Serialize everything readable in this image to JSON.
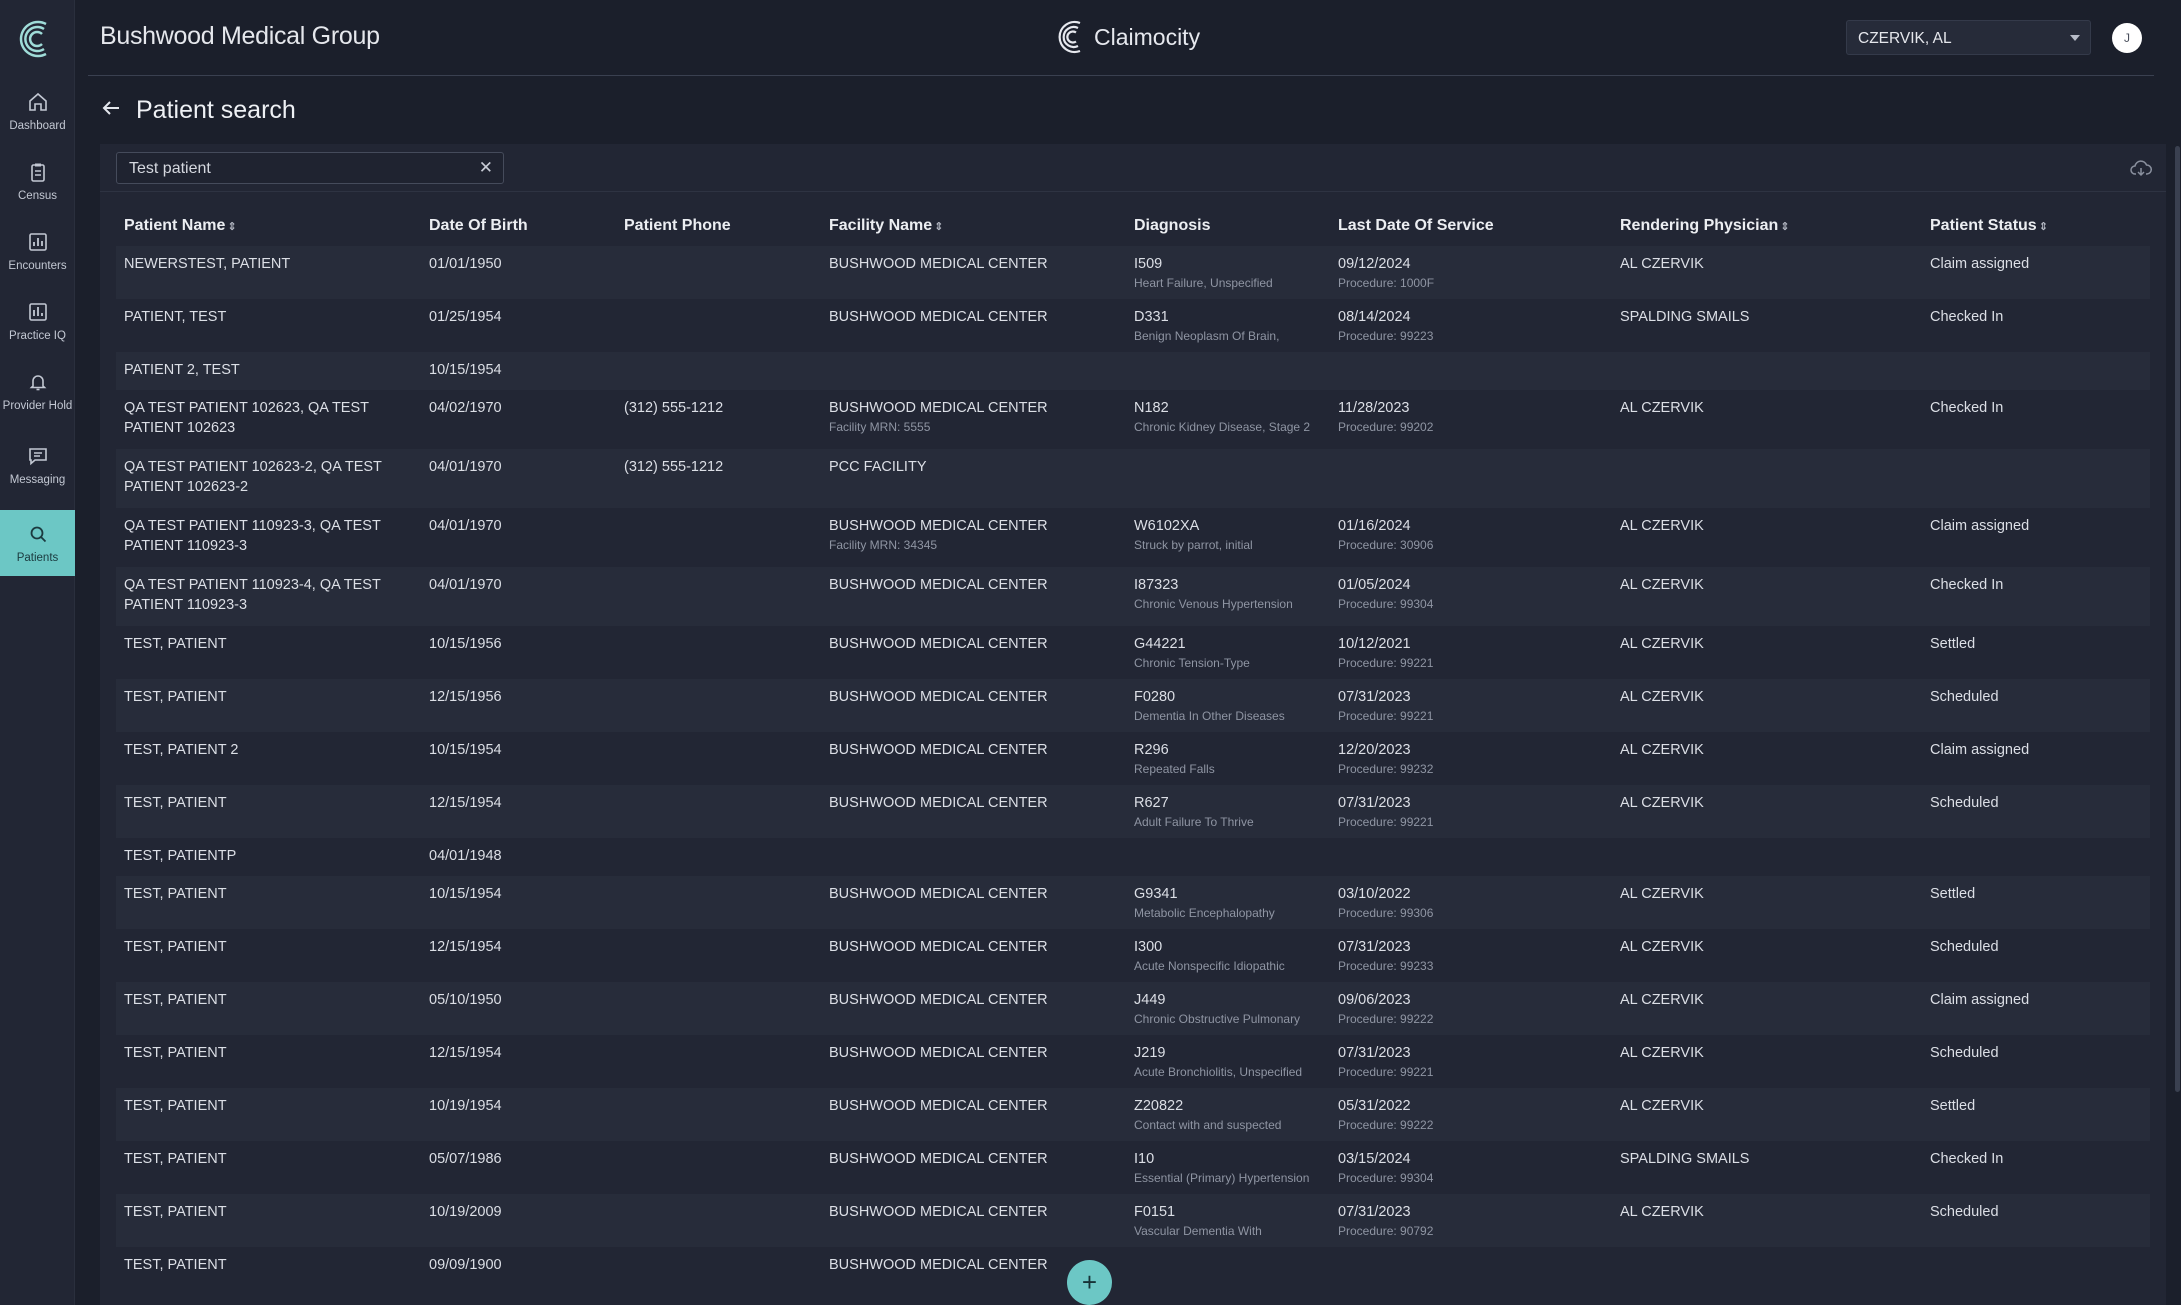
{
  "header": {
    "org_title": "Bushwood Medical Group",
    "brand": "Claimocity",
    "provider_select_value": "CZERVIK, AL",
    "avatar_initial": "J"
  },
  "sidebar": {
    "items": [
      {
        "label": "Dashboard",
        "icon": "home-icon"
      },
      {
        "label": "Census",
        "icon": "clipboard-icon"
      },
      {
        "label": "Encounters",
        "icon": "chart-icon"
      },
      {
        "label": "Practice IQ",
        "icon": "bar-chart-icon"
      },
      {
        "label": "Provider Hold",
        "icon": "bell-icon"
      },
      {
        "label": "Messaging",
        "icon": "message-icon"
      },
      {
        "label": "Patients",
        "icon": "search-icon",
        "active": true
      }
    ],
    "accent": "#6cc7c5"
  },
  "page": {
    "title": "Patient search",
    "search_value": "Test patient",
    "clear_symbol": "✕"
  },
  "table": {
    "columns": [
      {
        "label": "Patient Name",
        "sortable": true
      },
      {
        "label": "Date Of Birth",
        "sortable": false
      },
      {
        "label": "Patient Phone",
        "sortable": false
      },
      {
        "label": "Facility Name",
        "sortable": true
      },
      {
        "label": "Diagnosis",
        "sortable": false
      },
      {
        "label": "Last Date Of Service",
        "sortable": false
      },
      {
        "label": "Rendering Physician",
        "sortable": true
      },
      {
        "label": "Patient Status",
        "sortable": true
      }
    ],
    "rows": [
      {
        "name": "NEWERSTEST, PATIENT",
        "dob": "01/01/1950",
        "phone": "",
        "facility": "BUSHWOOD MEDICAL CENTER",
        "facility_sub": "",
        "dx_code": "I509",
        "dx_desc": "Heart Failure, Unspecified",
        "last_dos": "09/12/2024",
        "procedure": "Procedure: 1000F",
        "physician": "AL CZERVIK",
        "status": "Claim assigned"
      },
      {
        "name": "PATIENT, TEST",
        "dob": "01/25/1954",
        "phone": "",
        "facility": "BUSHWOOD MEDICAL CENTER",
        "facility_sub": "",
        "dx_code": "D331",
        "dx_desc": "Benign Neoplasm Of Brain,",
        "last_dos": "08/14/2024",
        "procedure": "Procedure: 99223",
        "physician": "SPALDING SMAILS",
        "status": "Checked In"
      },
      {
        "name": "PATIENT 2, TEST",
        "dob": "10/15/1954",
        "phone": "",
        "facility": "",
        "facility_sub": "",
        "dx_code": "",
        "dx_desc": "",
        "last_dos": "",
        "procedure": "",
        "physician": "",
        "status": ""
      },
      {
        "name": "QA TEST PATIENT 102623, QA TEST PATIENT 102623",
        "dob": "04/02/1970",
        "phone": "(312) 555-1212",
        "facility": "BUSHWOOD MEDICAL CENTER",
        "facility_sub": "Facility MRN: 5555",
        "dx_code": "N182",
        "dx_desc": "Chronic Kidney Disease, Stage 2",
        "last_dos": "11/28/2023",
        "procedure": "Procedure: 99202",
        "physician": "AL CZERVIK",
        "status": "Checked In"
      },
      {
        "name": "QA TEST PATIENT 102623-2, QA TEST PATIENT 102623-2",
        "dob": "04/01/1970",
        "phone": "(312) 555-1212",
        "facility": "PCC FACILITY",
        "facility_sub": "",
        "dx_code": "",
        "dx_desc": "",
        "last_dos": "",
        "procedure": "",
        "physician": "",
        "status": ""
      },
      {
        "name": "QA TEST PATIENT 110923-3, QA TEST PATIENT 110923-3",
        "dob": "04/01/1970",
        "phone": "",
        "facility": "BUSHWOOD MEDICAL CENTER",
        "facility_sub": "Facility MRN: 34345",
        "dx_code": "W6102XA",
        "dx_desc": "Struck by parrot, initial",
        "last_dos": "01/16/2024",
        "procedure": "Procedure: 30906",
        "physician": "AL CZERVIK",
        "status": "Claim assigned"
      },
      {
        "name": "QA TEST PATIENT 110923-4, QA TEST PATIENT 110923-3",
        "dob": "04/01/1970",
        "phone": "",
        "facility": "BUSHWOOD MEDICAL CENTER",
        "facility_sub": "",
        "dx_code": "I87323",
        "dx_desc": "Chronic Venous Hypertension",
        "last_dos": "01/05/2024",
        "procedure": "Procedure: 99304",
        "physician": "AL CZERVIK",
        "status": "Checked In"
      },
      {
        "name": "TEST, PATIENT",
        "dob": "10/15/1956",
        "phone": "",
        "facility": "BUSHWOOD MEDICAL CENTER",
        "facility_sub": "",
        "dx_code": "G44221",
        "dx_desc": "Chronic Tension-Type",
        "last_dos": "10/12/2021",
        "procedure": "Procedure: 99221",
        "physician": "AL CZERVIK",
        "status": "Settled"
      },
      {
        "name": "TEST, PATIENT",
        "dob": "12/15/1956",
        "phone": "",
        "facility": "BUSHWOOD MEDICAL CENTER",
        "facility_sub": "",
        "dx_code": "F0280",
        "dx_desc": "Dementia In Other Diseases",
        "last_dos": "07/31/2023",
        "procedure": "Procedure: 99221",
        "physician": "AL CZERVIK",
        "status": "Scheduled"
      },
      {
        "name": "TEST, PATIENT 2",
        "dob": "10/15/1954",
        "phone": "",
        "facility": "BUSHWOOD MEDICAL CENTER",
        "facility_sub": "",
        "dx_code": "R296",
        "dx_desc": "Repeated Falls",
        "last_dos": "12/20/2023",
        "procedure": "Procedure: 99232",
        "physician": "AL CZERVIK",
        "status": "Claim assigned"
      },
      {
        "name": "TEST, PATIENT",
        "dob": "12/15/1954",
        "phone": "",
        "facility": "BUSHWOOD MEDICAL CENTER",
        "facility_sub": "",
        "dx_code": "R627",
        "dx_desc": "Adult Failure To Thrive",
        "last_dos": "07/31/2023",
        "procedure": "Procedure: 99221",
        "physician": "AL CZERVIK",
        "status": "Scheduled"
      },
      {
        "name": "TEST, PATIENTP",
        "dob": "04/01/1948",
        "phone": "",
        "facility": "",
        "facility_sub": "",
        "dx_code": "",
        "dx_desc": "",
        "last_dos": "",
        "procedure": "",
        "physician": "",
        "status": ""
      },
      {
        "name": "TEST, PATIENT",
        "dob": "10/15/1954",
        "phone": "",
        "facility": "BUSHWOOD MEDICAL CENTER",
        "facility_sub": "",
        "dx_code": "G9341",
        "dx_desc": "Metabolic Encephalopathy",
        "last_dos": "03/10/2022",
        "procedure": "Procedure: 99306",
        "physician": "AL CZERVIK",
        "status": "Settled"
      },
      {
        "name": "TEST, PATIENT",
        "dob": "12/15/1954",
        "phone": "",
        "facility": "BUSHWOOD MEDICAL CENTER",
        "facility_sub": "",
        "dx_code": "I300",
        "dx_desc": "Acute Nonspecific Idiopathic",
        "last_dos": "07/31/2023",
        "procedure": "Procedure: 99233",
        "physician": "AL CZERVIK",
        "status": "Scheduled"
      },
      {
        "name": "TEST, PATIENT",
        "dob": "05/10/1950",
        "phone": "",
        "facility": "BUSHWOOD MEDICAL CENTER",
        "facility_sub": "",
        "dx_code": "J449",
        "dx_desc": "Chronic Obstructive Pulmonary",
        "last_dos": "09/06/2023",
        "procedure": "Procedure: 99222",
        "physician": "AL CZERVIK",
        "status": "Claim assigned"
      },
      {
        "name": "TEST, PATIENT",
        "dob": "12/15/1954",
        "phone": "",
        "facility": "BUSHWOOD MEDICAL CENTER",
        "facility_sub": "",
        "dx_code": "J219",
        "dx_desc": "Acute Bronchiolitis, Unspecified",
        "last_dos": "07/31/2023",
        "procedure": "Procedure: 99221",
        "physician": "AL CZERVIK",
        "status": "Scheduled"
      },
      {
        "name": "TEST, PATIENT",
        "dob": "10/19/1954",
        "phone": "",
        "facility": "BUSHWOOD MEDICAL CENTER",
        "facility_sub": "",
        "dx_code": "Z20822",
        "dx_desc": "Contact with and suspected",
        "last_dos": "05/31/2022",
        "procedure": "Procedure: 99222",
        "physician": "AL CZERVIK",
        "status": "Settled"
      },
      {
        "name": "TEST, PATIENT",
        "dob": "05/07/1986",
        "phone": "",
        "facility": "BUSHWOOD MEDICAL CENTER",
        "facility_sub": "",
        "dx_code": "I10",
        "dx_desc": "Essential (Primary) Hypertension",
        "last_dos": "03/15/2024",
        "procedure": "Procedure: 99304",
        "physician": "SPALDING SMAILS",
        "status": "Checked In"
      },
      {
        "name": "TEST, PATIENT",
        "dob": "10/19/2009",
        "phone": "",
        "facility": "BUSHWOOD MEDICAL CENTER",
        "facility_sub": "",
        "dx_code": "F0151",
        "dx_desc": "Vascular Dementia With",
        "last_dos": "07/31/2023",
        "procedure": "Procedure: 90792",
        "physician": "AL CZERVIK",
        "status": "Scheduled"
      },
      {
        "name": "TEST, PATIENT",
        "dob": "09/09/1900",
        "phone": "",
        "facility": "BUSHWOOD MEDICAL CENTER",
        "facility_sub": "",
        "dx_code": "",
        "dx_desc": "",
        "last_dos": "",
        "procedure": "",
        "physician": "",
        "status": ""
      }
    ]
  },
  "fab": {
    "label": "+"
  }
}
